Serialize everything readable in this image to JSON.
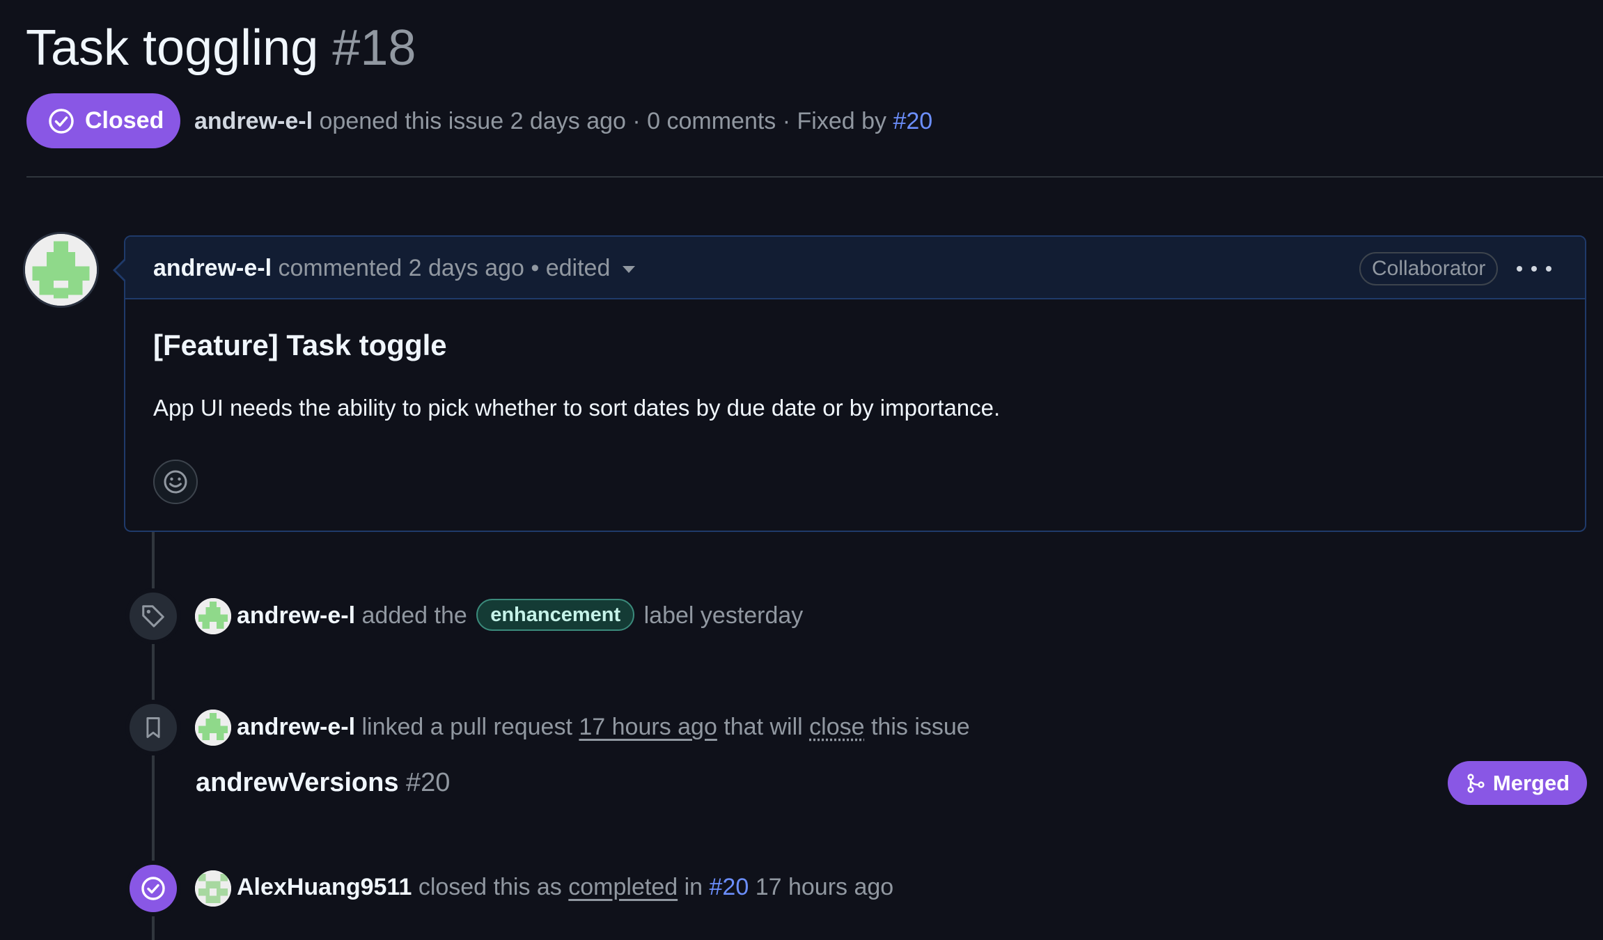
{
  "issue": {
    "title": "Task toggling",
    "number": "#18",
    "state_label": "Closed",
    "author": "andrew-e-l",
    "opened_text": "opened this issue 2 days ago · 0 comments · Fixed by",
    "fixed_by": "#20"
  },
  "comment": {
    "author": "andrew-e-l",
    "meta_text": "commented 2 days ago • edited",
    "role": "Collaborator",
    "heading": "[Feature] Task toggle",
    "body": "App UI needs the ability to pick whether to sort dates by due date or by importance."
  },
  "timeline": {
    "label_event": {
      "author": "andrew-e-l",
      "pre": "added the",
      "label": "enhancement",
      "post": "label yesterday"
    },
    "link_event": {
      "author": "andrew-e-l",
      "pre": "linked a pull request",
      "time": "17 hours ago",
      "mid": "that will",
      "action": "close",
      "post": "this issue",
      "pr_title": "andrewVersions",
      "pr_number": "#20",
      "pr_state": "Merged"
    },
    "close_event": {
      "author": "AlexHuang9511",
      "pre": "closed this as",
      "reason": "completed",
      "in": "in",
      "ref": "#20",
      "time": "17 hours ago"
    }
  },
  "colors": {
    "background": "#0f111a",
    "closed_purple": "#8957e5",
    "link_blue": "#6c8ffd",
    "label_teal": "#3b8a7b",
    "identicon_green": "#8fd98a"
  },
  "icons": [
    "issue-closed-icon",
    "caret-down-icon",
    "kebab-icon",
    "smiley-icon",
    "tag-icon",
    "bookmark-icon",
    "check-circle-icon",
    "git-merge-icon"
  ]
}
